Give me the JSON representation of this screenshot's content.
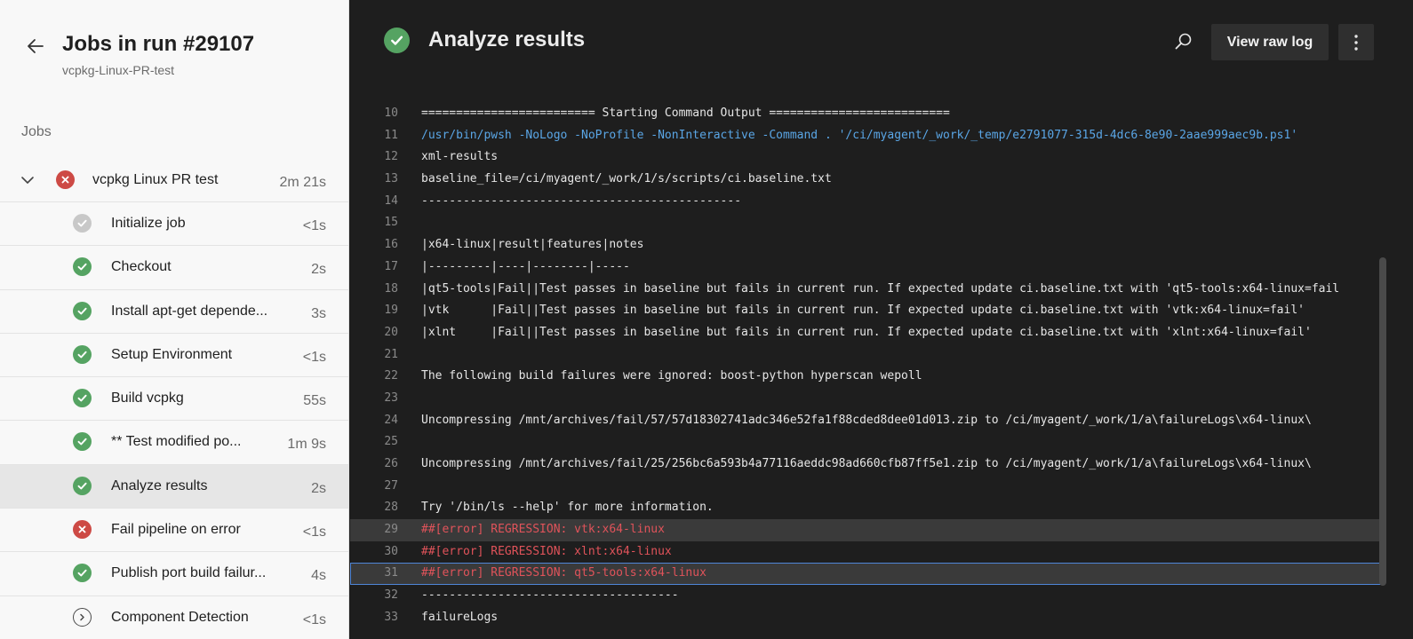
{
  "sidebar": {
    "title": "Jobs in run #29107",
    "subtitle": "vcpkg-Linux-PR-test",
    "jobs_heading": "Jobs",
    "job": {
      "name": "vcpkg Linux PR test",
      "duration": "2m 21s",
      "status": "fail"
    },
    "steps": [
      {
        "name": "Initialize job",
        "duration": "<1s",
        "status": "skipped"
      },
      {
        "name": "Checkout",
        "duration": "2s",
        "status": "success"
      },
      {
        "name": "Install apt-get depende...",
        "duration": "3s",
        "status": "success"
      },
      {
        "name": "Setup Environment",
        "duration": "<1s",
        "status": "success"
      },
      {
        "name": "Build vcpkg",
        "duration": "55s",
        "status": "success"
      },
      {
        "name": "** Test modified po...",
        "duration": "1m 9s",
        "status": "success"
      },
      {
        "name": "Analyze results",
        "duration": "2s",
        "status": "success",
        "selected": true
      },
      {
        "name": "Fail pipeline on error",
        "duration": "<1s",
        "status": "fail"
      },
      {
        "name": "Publish port build failur...",
        "duration": "4s",
        "status": "success"
      },
      {
        "name": "Component Detection",
        "duration": "<1s",
        "status": "pending"
      }
    ]
  },
  "main": {
    "title": "Analyze results",
    "status": "success",
    "raw_log_label": "View raw log"
  },
  "log": [
    {
      "n": "10",
      "text": "========================= Starting Command Output ==========================",
      "kind": "normal"
    },
    {
      "n": "11",
      "text": "/usr/bin/pwsh -NoLogo -NoProfile -NonInteractive -Command . '/ci/myagent/_work/_temp/e2791077-315d-4dc6-8e90-2aae999aec9b.ps1'",
      "kind": "cmd"
    },
    {
      "n": "12",
      "text": "xml-results",
      "kind": "normal"
    },
    {
      "n": "13",
      "text": "baseline_file=/ci/myagent/_work/1/s/scripts/ci.baseline.txt",
      "kind": "normal"
    },
    {
      "n": "14",
      "text": "----------------------------------------------",
      "kind": "normal"
    },
    {
      "n": "15",
      "text": "",
      "kind": "normal"
    },
    {
      "n": "16",
      "text": "|x64-linux|result|features|notes",
      "kind": "normal"
    },
    {
      "n": "17",
      "text": "|---------|----|--------|-----",
      "kind": "normal"
    },
    {
      "n": "18",
      "text": "|qt5-tools|Fail||Test passes in baseline but fails in current run. If expected update ci.baseline.txt with 'qt5-tools:x64-linux=fail",
      "kind": "normal"
    },
    {
      "n": "19",
      "text": "|vtk      |Fail||Test passes in baseline but fails in current run. If expected update ci.baseline.txt with 'vtk:x64-linux=fail'",
      "kind": "normal"
    },
    {
      "n": "20",
      "text": "|xlnt     |Fail||Test passes in baseline but fails in current run. If expected update ci.baseline.txt with 'xlnt:x64-linux=fail'",
      "kind": "normal"
    },
    {
      "n": "21",
      "text": "",
      "kind": "normal"
    },
    {
      "n": "22",
      "text": "The following build failures were ignored: boost-python hyperscan wepoll",
      "kind": "normal"
    },
    {
      "n": "23",
      "text": "",
      "kind": "normal"
    },
    {
      "n": "24",
      "text": "Uncompressing /mnt/archives/fail/57/57d18302741adc346e52fa1f88cded8dee01d013.zip to /ci/myagent/_work/1/a\\failureLogs\\x64-linux\\",
      "kind": "normal"
    },
    {
      "n": "25",
      "text": "",
      "kind": "normal"
    },
    {
      "n": "26",
      "text": "Uncompressing /mnt/archives/fail/25/256bc6a593b4a77116aeddc98ad660cfb87ff5e1.zip to /ci/myagent/_work/1/a\\failureLogs\\x64-linux\\",
      "kind": "normal"
    },
    {
      "n": "27",
      "text": "",
      "kind": "normal"
    },
    {
      "n": "28",
      "text": "Try '/bin/ls --help' for more information.",
      "kind": "normal"
    },
    {
      "n": "29",
      "text": "##[error] REGRESSION: vtk:x64-linux",
      "kind": "error",
      "highlight": true
    },
    {
      "n": "30",
      "text": "##[error] REGRESSION: xlnt:x64-linux",
      "kind": "error"
    },
    {
      "n": "31",
      "text": "##[error] REGRESSION: qt5-tools:x64-linux",
      "kind": "error",
      "highlight": true,
      "focused": true
    },
    {
      "n": "32",
      "text": "-------------------------------------",
      "kind": "normal"
    },
    {
      "n": "33",
      "text": "failureLogs",
      "kind": "normal"
    }
  ],
  "colors": {
    "success": "#55a362",
    "fail": "#cd4a45",
    "skipped": "#c8c8c8",
    "error_text": "#e0535a",
    "cmd_text": "#5aa6e6",
    "focus_outline": "#4f86d8"
  },
  "icons": {
    "back": "arrow-left-icon",
    "chevron": "chevron-down-icon",
    "search": "search-icon",
    "more": "more-vertical-icon"
  }
}
